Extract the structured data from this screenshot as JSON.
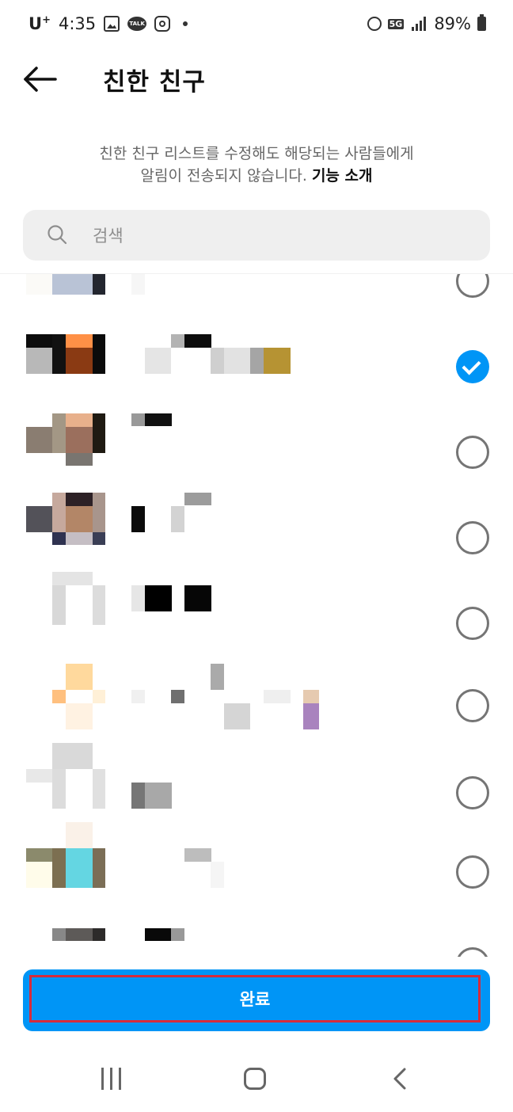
{
  "status_bar": {
    "carrier": "U",
    "carrier_sup": "+",
    "time": "4:35",
    "talk": "TALK",
    "network": "5G",
    "battery": "89%"
  },
  "header": {
    "title": "친한 친구"
  },
  "info": {
    "line1": "친한 친구 리스트를 수정해도 해당되는 사람들에게",
    "line2": "알림이 전송되지 않습니다.",
    "link": "기능 소개"
  },
  "search": {
    "placeholder": "검색"
  },
  "friends": [
    {
      "selected": false
    },
    {
      "selected": true
    },
    {
      "selected": false
    },
    {
      "selected": false
    },
    {
      "selected": false
    },
    {
      "selected": false
    },
    {
      "selected": false
    },
    {
      "selected": false
    },
    {
      "selected": false
    }
  ],
  "done_button": {
    "label": "완료"
  },
  "colors": {
    "accent": "#0095f6",
    "highlight_border": "#d62b3c",
    "search_bg": "#efefef"
  }
}
